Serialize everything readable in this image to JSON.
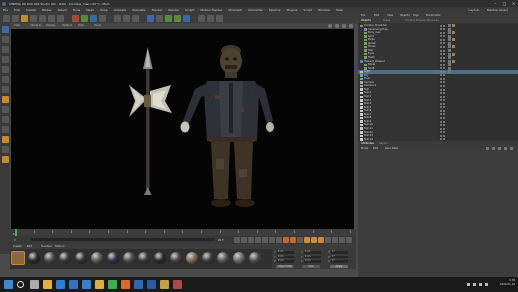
{
  "window": {
    "title": "CINEMA 4D R20.026 Studio (RC - R20) - [zombie_man.c4d *] - Main"
  },
  "menus": [
    "File",
    "Edit",
    "Create",
    "Modes",
    "Select",
    "Tools",
    "Mesh",
    "Snap",
    "Animate",
    "Simulate",
    "Tracker",
    "Render",
    "Sculpt",
    "Motion Tracker",
    "MoGraph",
    "Character",
    "Pipeline",
    "Plugins",
    "Script",
    "Window",
    "Help"
  ],
  "layout": {
    "label": "Layout:",
    "value": "Startup (User)"
  },
  "viewport": {
    "menus": [
      "View",
      "Cameras",
      "Display",
      "Options",
      "Filter",
      "Panel"
    ],
    "frame_start": "0",
    "frame_end": "90 F"
  },
  "material_manager": {
    "tabs": [
      "Create",
      "Edit",
      "Function",
      "Texture"
    ],
    "material_colors": [
      "#8a6a3a",
      "#2a2a2a",
      "#4a4a4a",
      "#3a3a3a",
      "#333333",
      "#5a5a5a",
      "#2e3440",
      "#4c4c4c",
      "#3a3a3a",
      "#2a2a2a",
      "#444444",
      "#7a6a52",
      "#3e3e3e",
      "#555555",
      "#6a6a6a",
      "#505050"
    ]
  },
  "coordinates": {
    "rows": [
      {
        "label": "X",
        "value": "0 cm",
        "label2": "X",
        "value2": "0 cm",
        "label3": "H",
        "value3": "0 °"
      },
      {
        "label": "Y",
        "value": "0 cm",
        "label2": "Y",
        "value2": "0 cm",
        "label3": "P",
        "value3": "0 °"
      },
      {
        "label": "Z",
        "value": "0 cm",
        "label2": "Z",
        "value2": "0 cm",
        "label3": "B",
        "value3": "0 °"
      }
    ],
    "mode_select": "Object (Rel)",
    "size_select": "Size",
    "apply_button": "Apply"
  },
  "object_manager": {
    "tabs": [
      "Objects",
      "Takes",
      "Content Browser",
      "Structure"
    ],
    "menus": [
      "File",
      "Edit",
      "View",
      "Objects",
      "Tags",
      "Bookmarks"
    ],
    "objects": [
      {
        "name": "Zombie_Character",
        "color": "#7aa04a",
        "indent": 0,
        "selected": false
      },
      {
        "name": "mixamorig:Hips",
        "color": "#9a7acc",
        "indent": 1,
        "selected": false
      },
      {
        "name": "Body_Geo",
        "color": "#7aa04a",
        "indent": 1,
        "selected": false
      },
      {
        "name": "Shirt",
        "color": "#7aa04a",
        "indent": 1,
        "selected": false
      },
      {
        "name": "Pants",
        "color": "#7aa04a",
        "indent": 1,
        "selected": false
      },
      {
        "name": "Jacket",
        "color": "#7aa04a",
        "indent": 1,
        "selected": false
      },
      {
        "name": "Shoes",
        "color": "#7aa04a",
        "indent": 1,
        "selected": false
      },
      {
        "name": "Hair",
        "color": "#7aa04a",
        "indent": 1,
        "selected": false
      },
      {
        "name": "Eyes",
        "color": "#7aa04a",
        "indent": 1,
        "selected": false
      },
      {
        "name": "Teeth",
        "color": "#7aa04a",
        "indent": 1,
        "selected": false
      },
      {
        "name": "Halberd_Weapon",
        "color": "#4a8acc",
        "indent": 0,
        "selected": false
      },
      {
        "name": "Blade",
        "color": "#7aa04a",
        "indent": 1,
        "selected": false
      },
      {
        "name": "Shaft",
        "color": "#7aa04a",
        "indent": 1,
        "selected": false
      },
      {
        "name": "Light",
        "color": "#cccc5a",
        "indent": 0,
        "selected": true
      },
      {
        "name": "Sky",
        "color": "#5aaacc",
        "indent": 0,
        "selected": false
      },
      {
        "name": "Floor",
        "color": "#5aaacc",
        "indent": 0,
        "selected": false
      },
      {
        "name": "Camera",
        "color": "#aaaaaa",
        "indent": 0,
        "selected": false
      },
      {
        "name": "Camera.1",
        "color": "#aaaaaa",
        "indent": 0,
        "selected": false
      },
      {
        "name": "Null",
        "color": "#cccccc",
        "indent": 0,
        "selected": false
      },
      {
        "name": "Null.1",
        "color": "#cccccc",
        "indent": 0,
        "selected": false
      },
      {
        "name": "Null.2",
        "color": "#cccccc",
        "indent": 0,
        "selected": false
      },
      {
        "name": "Null.3",
        "color": "#cccccc",
        "indent": 0,
        "selected": false
      },
      {
        "name": "Null.4",
        "color": "#cccccc",
        "indent": 0,
        "selected": false
      },
      {
        "name": "Null.5",
        "color": "#cccccc",
        "indent": 0,
        "selected": false
      },
      {
        "name": "Null.6",
        "color": "#cccccc",
        "indent": 0,
        "selected": false
      },
      {
        "name": "Null.7",
        "color": "#cccccc",
        "indent": 0,
        "selected": false
      },
      {
        "name": "Null.8",
        "color": "#cccccc",
        "indent": 0,
        "selected": false
      },
      {
        "name": "Null.9",
        "color": "#cccccc",
        "indent": 0,
        "selected": false
      },
      {
        "name": "Null.10",
        "color": "#cccccc",
        "indent": 0,
        "selected": false
      },
      {
        "name": "Null.11",
        "color": "#cccccc",
        "indent": 0,
        "selected": false
      },
      {
        "name": "Null.12",
        "color": "#cccccc",
        "indent": 0,
        "selected": false
      },
      {
        "name": "Null.13",
        "color": "#cccccc",
        "indent": 0,
        "selected": false
      },
      {
        "name": "Null.14",
        "color": "#cccccc",
        "indent": 0,
        "selected": false
      }
    ]
  },
  "attribute_manager": {
    "tabs": [
      "Attributes",
      "Layers"
    ],
    "menus": [
      "Mode",
      "Edit",
      "User Data"
    ]
  },
  "taskbar": {
    "time": "3:38",
    "date": "2020-01-16"
  },
  "colors": {
    "accent": "#c98a2e",
    "timeline_cursor": "#48b848",
    "selection": "#4f6e8a"
  }
}
